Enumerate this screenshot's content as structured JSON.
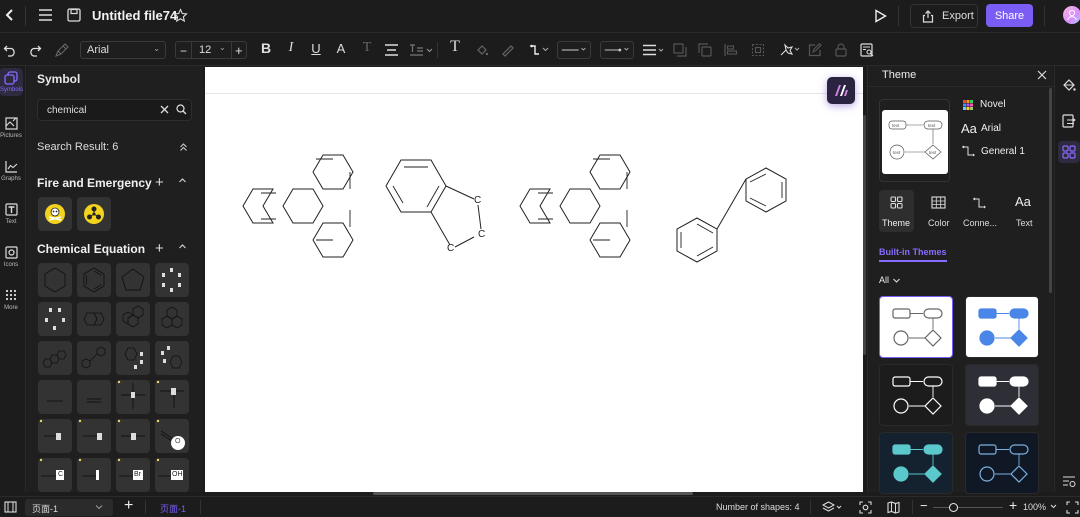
{
  "app": {
    "file_title": "Untitled file74"
  },
  "topbar": {
    "export_label": "Export",
    "share_label": "Share",
    "accent": "#7b5cf5"
  },
  "toolbar": {
    "font_family": "Arial",
    "font_size": "12"
  },
  "left_rail": {
    "items": [
      {
        "label": "Symbols",
        "icon": "symbols-icon",
        "active": true
      },
      {
        "label": "Pictures",
        "icon": "pictures-icon"
      },
      {
        "label": "Graphs",
        "icon": "graphs-icon"
      },
      {
        "label": "Text",
        "icon": "text-icon"
      },
      {
        "label": "Icons",
        "icon": "icons-icon"
      },
      {
        "label": "More",
        "icon": "more-icon"
      }
    ]
  },
  "symbol_panel": {
    "title": "Symbol",
    "search_value": "chemical",
    "search_result_label": "Search Result: 6",
    "sections": [
      {
        "title": "Fire and Emergency",
        "items": [
          "toxic-skull",
          "biohazard-radiation"
        ]
      },
      {
        "title": "Chemical Equation",
        "items": [
          "cyclohexane",
          "benzene",
          "cyclopentane",
          "cyclooctane-atoms",
          "ring-atoms",
          "naphthalene",
          "phenanthrene",
          "pyrene",
          "triphenylene",
          "biphenyl",
          "indane",
          "indene",
          "single-bond",
          "double-bond",
          "carbon-cross",
          "nitrogen",
          "hydrogen",
          "fluorine",
          "oxygen-bond",
          "hydroxyl-circle",
          "chlorine",
          "iodine",
          "bromine",
          "hydroxyl"
        ]
      }
    ],
    "tile_labels": {
      "C": "C",
      "I": "I",
      "Br": "Br",
      "OH": "OH",
      "O": "O"
    }
  },
  "canvas": {
    "shapes": [
      {
        "name": "triphenylene"
      },
      {
        "name": "indane",
        "atoms": [
          "C",
          "C",
          "C"
        ]
      },
      {
        "name": "triphenylene-2"
      },
      {
        "name": "biphenyl"
      }
    ]
  },
  "theme_panel": {
    "title": "Theme",
    "preview_text": "text",
    "current": {
      "palette": "Novel",
      "font": "Arial",
      "connector": "General 1"
    },
    "tabs": [
      {
        "label": "Theme",
        "active": true
      },
      {
        "label": "Color"
      },
      {
        "label": "Conne..."
      },
      {
        "label": "Text"
      }
    ],
    "built_in_label": "Built-in Themes",
    "filter_label": "All",
    "themes": [
      {
        "bg": "#ffffff",
        "stroke": "#666666",
        "fill": "none",
        "selected": true
      },
      {
        "bg": "#ffffff",
        "stroke": "#4a86e8",
        "fill": "#4a86e8"
      },
      {
        "bg": "#1c1c1c",
        "stroke": "#ffffff",
        "fill": "none"
      },
      {
        "bg": "#2e2e36",
        "stroke": "#ffffff",
        "fill": "#ffffff"
      },
      {
        "bg": "#13222e",
        "stroke": "#5bc8cc",
        "fill": "#5bc8cc"
      },
      {
        "bg": "#0f1824",
        "stroke": "#7ab0e0",
        "fill": "none"
      }
    ]
  },
  "bottombar": {
    "page_select": "页面-1",
    "page_tab": "页面-1",
    "shape_count_label": "Number of shapes: 4",
    "zoom_label": "100%",
    "zoom_level": 1.0
  }
}
